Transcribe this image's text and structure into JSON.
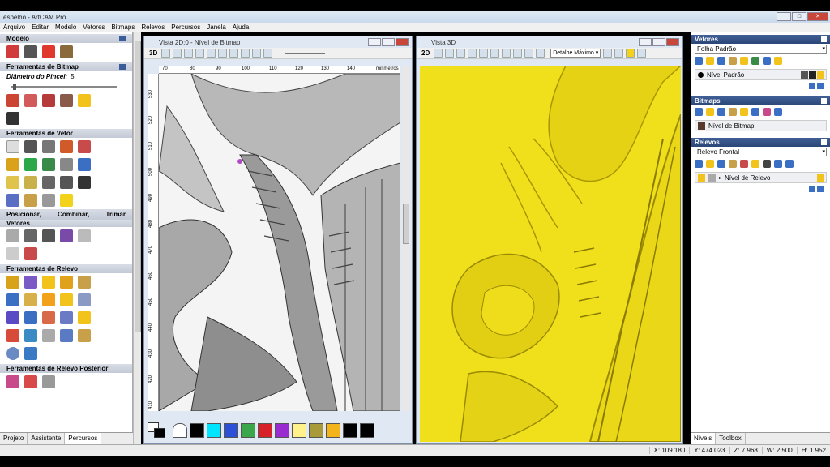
{
  "window": {
    "title": "espelho - ArtCAM Pro"
  },
  "menu": [
    "Arquivo",
    "Editar",
    "Modelo",
    "Vetores",
    "Bitmaps",
    "Relevos",
    "Percursos",
    "Janela",
    "Ajuda"
  ],
  "left_panel": {
    "sections": {
      "modelo": "Modelo",
      "bitmap_tools": "Ferramentas de Bitmap",
      "vetor_tools": "Ferramentas de Vetor",
      "posicionar": [
        "Posicionar,",
        "Combinar,",
        "Trimar"
      ],
      "posicionar_sub": "Vetores",
      "relevo_tools": "Ferramentas de Relevo",
      "relevo_posterior": "Ferramentas de Relevo Posterior"
    },
    "brush_label": "Diâmetro do Pincel:",
    "brush_value": "5",
    "tabs": [
      "Projeto",
      "Assistente",
      "Percursos"
    ]
  },
  "view2d": {
    "title": "Vista 2D:0 - Nível de Bitmap",
    "mode_label": "3D",
    "ruler_h": [
      "70",
      "80",
      "90",
      "100",
      "110",
      "120",
      "130",
      "140",
      "milímetros"
    ],
    "ruler_v": [
      "530",
      "520",
      "510",
      "500",
      "490",
      "480",
      "470",
      "460",
      "450",
      "440",
      "430",
      "420",
      "410"
    ],
    "palette": [
      "#ffffff",
      "#000000",
      "#00e5ff",
      "#2b4fd6",
      "#3aa84a",
      "#d8202a",
      "#9a2bd0",
      "#fff28a",
      "#a89a3a",
      "#f2b41a",
      "#000000",
      "#000000"
    ]
  },
  "view3d": {
    "title": "Vista 3D",
    "mode_label": "2D",
    "detail_select": "Detalhe Máximo"
  },
  "right_panel": {
    "vetores": {
      "title": "Vetores",
      "select": "Folha Padrão",
      "layer": "Nível Padrão"
    },
    "bitmaps": {
      "title": "Bitmaps",
      "layer": "Nível de Bitmap"
    },
    "relevos": {
      "title": "Relevos",
      "select": "Relevo Frontal",
      "layer": "Nível de Relevo"
    },
    "tabs": [
      "Níveis",
      "Toolbox"
    ]
  },
  "status": {
    "x": "X: 109.180",
    "y": "Y: 474.023",
    "z": "Z: 7.968",
    "w": "W: 2.500",
    "h": "H: 1.952"
  }
}
